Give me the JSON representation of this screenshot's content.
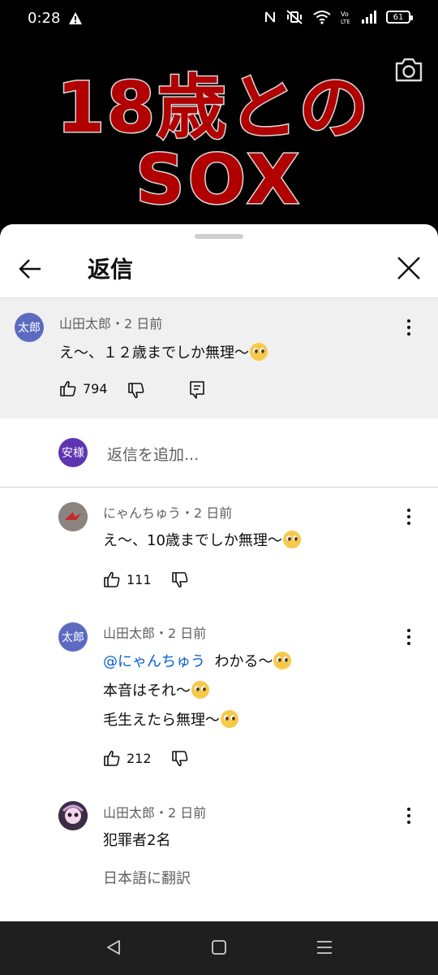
{
  "status": {
    "time": "0:28",
    "battery": "61"
  },
  "video": {
    "line1": "18歳との",
    "line2": "SOX"
  },
  "sheet": {
    "title": "返信"
  },
  "parent_comment": {
    "avatar_text": "太郎",
    "meta": "山田太郎・2 日前",
    "text": "え〜、１２歳までしか無理〜",
    "likes": "794"
  },
  "add_reply": {
    "avatar_text": "安様",
    "placeholder": "返信を追加..."
  },
  "replies": [
    {
      "meta": "にゃんちゅう・2 日前",
      "text": "え〜、10歳までしか無理〜",
      "likes": "111"
    },
    {
      "avatar_text": "太郎",
      "meta": "山田太郎・2 日前",
      "mention": "@にゃんちゅう",
      "line1": "わかる〜",
      "line2": "本音はそれ〜",
      "line3": "毛生えたら無理〜",
      "likes": "212"
    },
    {
      "meta": "山田太郎・2 日前",
      "text": "犯罪者2名",
      "translate": "日本語に翻訳"
    }
  ]
}
